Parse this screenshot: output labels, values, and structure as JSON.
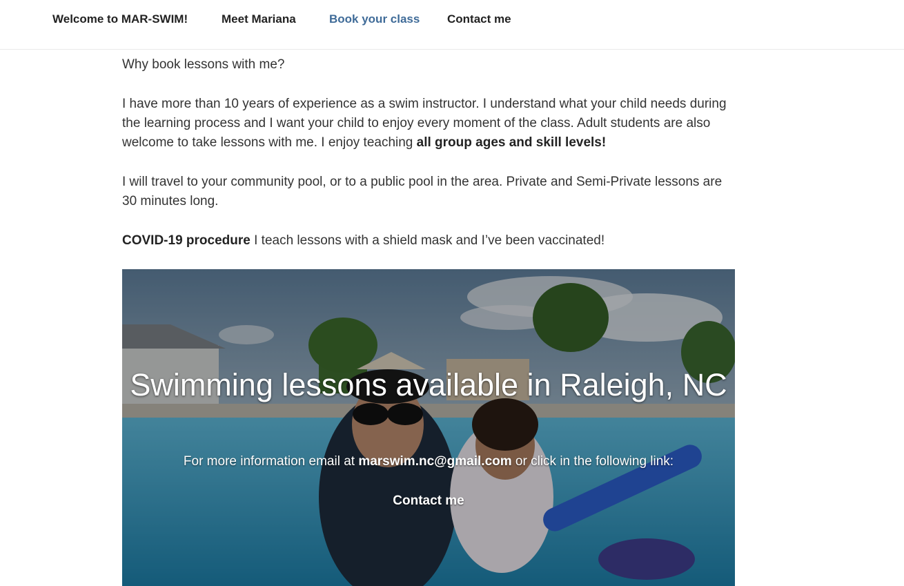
{
  "nav": {
    "items": [
      {
        "label": "Welcome to MAR-SWIM!",
        "active": false
      },
      {
        "label": "Meet Mariana",
        "active": false
      },
      {
        "label": "Book your class",
        "active": true
      },
      {
        "label": "Contact me",
        "active": false
      }
    ],
    "active_color": "#3f6b98"
  },
  "content": {
    "question": "Why book lessons with me?",
    "experience_text": "I have more than 10 years of experience as a swim instructor. I understand what your child needs during the learning process and I want your child to enjoy every moment of the class. Adult students are also welcome to take lessons with me. I enjoy teaching ",
    "experience_bold": "all group ages and skill levels!",
    "travel_text": "I will travel to your community pool, or to a public pool in the area. Private and Semi-Private lessons are 30 minutes long.",
    "covid_bold": "COVID-19 procedure",
    "covid_text": " I teach lessons with a shield mask and I’ve been vaccinated!"
  },
  "cover": {
    "title": "Swimming lessons available in Raleigh, NC",
    "info_prefix": "For more information email at ",
    "email": "marswim.nc@gmail.com",
    "info_suffix": " or click in the following link:",
    "link_label": "Contact me"
  }
}
